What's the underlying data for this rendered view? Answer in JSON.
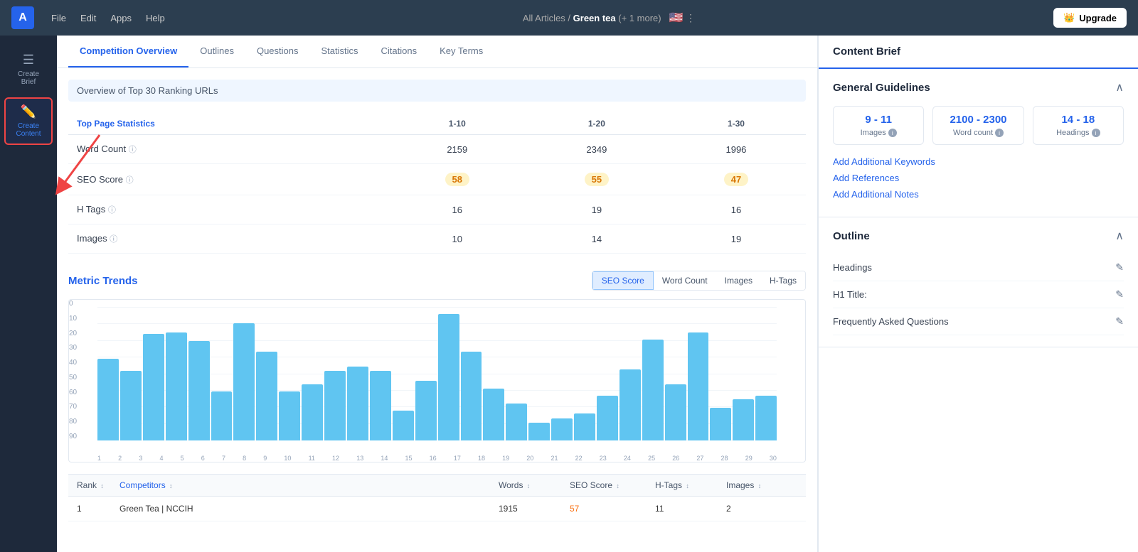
{
  "topbar": {
    "logo": "A",
    "menu": [
      "File",
      "Edit",
      "Apps",
      "Help"
    ],
    "breadcrumb_prefix": "All Articles /",
    "keyword": "Green tea",
    "breadcrumb_suffix": "(+ 1 more)",
    "upgrade_label": "Upgrade"
  },
  "sidebar": {
    "items": [
      {
        "id": "create-brief",
        "icon": "☰",
        "label": "Create\nBrief",
        "active": false
      },
      {
        "id": "create-content",
        "icon": "✏️",
        "label": "Create\nContent",
        "active": true
      }
    ]
  },
  "tabs": {
    "items": [
      {
        "id": "competition-overview",
        "label": "Competition Overview",
        "active": true
      },
      {
        "id": "outlines",
        "label": "Outlines",
        "active": false
      },
      {
        "id": "questions",
        "label": "Questions",
        "active": false
      },
      {
        "id": "statistics",
        "label": "Statistics",
        "active": false
      },
      {
        "id": "citations",
        "label": "Citations",
        "active": false
      },
      {
        "id": "key-terms",
        "label": "Key Terms",
        "active": false
      }
    ]
  },
  "overview": {
    "section_title": "Overview of Top 30 Ranking URLs",
    "top_page_stats_label": "Top Page Statistics",
    "range_1_10": "1-10",
    "range_1_20": "1-20",
    "range_1_30": "1-30",
    "rows": [
      {
        "metric": "Word Count",
        "v1": "2159",
        "v2": "2349",
        "v3": "1996",
        "type": "number"
      },
      {
        "metric": "SEO Score",
        "v1": "58",
        "v2": "55",
        "v3": "47",
        "type": "score"
      },
      {
        "metric": "H Tags",
        "v1": "16",
        "v2": "19",
        "v3": "16",
        "type": "number"
      },
      {
        "metric": "Images",
        "v1": "10",
        "v2": "14",
        "v3": "19",
        "type": "number"
      }
    ]
  },
  "metric_trends": {
    "title": "Metric Trends",
    "buttons": [
      "SEO Score",
      "Word Count",
      "Images",
      "H-Tags"
    ],
    "active_button": "SEO Score",
    "y_axis": [
      "0",
      "10",
      "20",
      "30",
      "40",
      "50",
      "60",
      "70",
      "80",
      "90"
    ],
    "x_axis": [
      "1",
      "2",
      "3",
      "4",
      "5",
      "6",
      "7",
      "8",
      "9",
      "10",
      "11",
      "12",
      "13",
      "14",
      "15",
      "16",
      "17",
      "18",
      "19",
      "20",
      "21",
      "22",
      "23",
      "24",
      "25",
      "26",
      "27",
      "28",
      "29",
      "30"
    ],
    "bars": [
      55,
      47,
      72,
      73,
      67,
      33,
      79,
      60,
      33,
      38,
      47,
      50,
      47,
      20,
      40,
      85,
      60,
      35,
      25,
      12,
      15,
      18,
      30,
      48,
      68,
      38,
      73,
      22,
      28,
      30
    ]
  },
  "competitors": {
    "headers": [
      "Rank",
      "Competitors",
      "Words",
      "SEO Score",
      "H-Tags",
      "Images"
    ],
    "rows": [
      {
        "rank": "1",
        "name": "Green Tea | NCCIH",
        "words": "1915",
        "seo": "57",
        "htags": "11",
        "images": "2"
      }
    ]
  },
  "right_panel": {
    "title": "Content Brief",
    "general_guidelines": {
      "title": "General Guidelines",
      "cards": [
        {
          "value": "9 - 11",
          "label": "Images",
          "id": "images-card"
        },
        {
          "value": "2100 - 2300",
          "label": "Word count",
          "id": "word-count-card"
        },
        {
          "value": "14 - 18",
          "label": "Headings",
          "id": "headings-card"
        }
      ],
      "links": [
        {
          "label": "Add Additional Keywords",
          "id": "add-keywords"
        },
        {
          "label": "Add References",
          "id": "add-references"
        },
        {
          "label": "Add Additional Notes",
          "id": "add-notes"
        }
      ]
    },
    "outline": {
      "title": "Outline",
      "items": [
        {
          "label": "Headings",
          "id": "headings-item"
        },
        {
          "label": "H1 Title:",
          "id": "h1-title-item"
        },
        {
          "label": "Frequently Asked Questions",
          "id": "faq-item"
        }
      ]
    }
  }
}
